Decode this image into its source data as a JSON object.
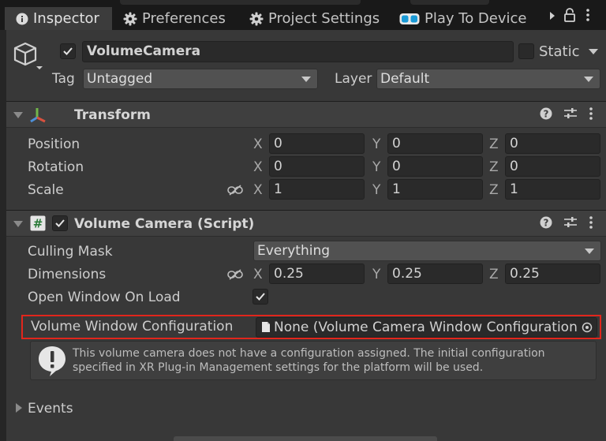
{
  "tabs": {
    "inspector": "Inspector",
    "preferences": "Preferences",
    "project_settings": "Project Settings",
    "play_to_device": "Play To Device"
  },
  "gameobject": {
    "active": true,
    "name": "VolumeCamera",
    "static_label": "Static",
    "static": false,
    "tag_label": "Tag",
    "tag_value": "Untagged",
    "layer_label": "Layer",
    "layer_value": "Default"
  },
  "transform": {
    "title": "Transform",
    "rows": [
      {
        "label": "Position",
        "x": "0",
        "y": "0",
        "z": "0"
      },
      {
        "label": "Rotation",
        "x": "0",
        "y": "0",
        "z": "0"
      },
      {
        "label": "Scale",
        "x": "1",
        "y": "1",
        "z": "1"
      }
    ],
    "axes": {
      "x": "X",
      "y": "Y",
      "z": "Z"
    }
  },
  "volume_camera": {
    "title": "Volume Camera (Script)",
    "enabled": true,
    "culling_mask_label": "Culling Mask",
    "culling_mask_value": "Everything",
    "dimensions_label": "Dimensions",
    "dimensions": {
      "x": "0.25",
      "y": "0.25",
      "z": "0.25"
    },
    "open_window_label": "Open Window On Load",
    "open_window": true,
    "config_label": "Volume Window Configuration",
    "config_value": "None (Volume Camera Window Configuration)",
    "help_line1": "This volume camera does not have a configuration assigned. The initial configuration",
    "help_line2": "specified in XR Plug-in Management settings for the platform will be used."
  },
  "events": {
    "label": "Events"
  },
  "colors": {
    "highlight": "#e1261c",
    "background": "#383838"
  }
}
